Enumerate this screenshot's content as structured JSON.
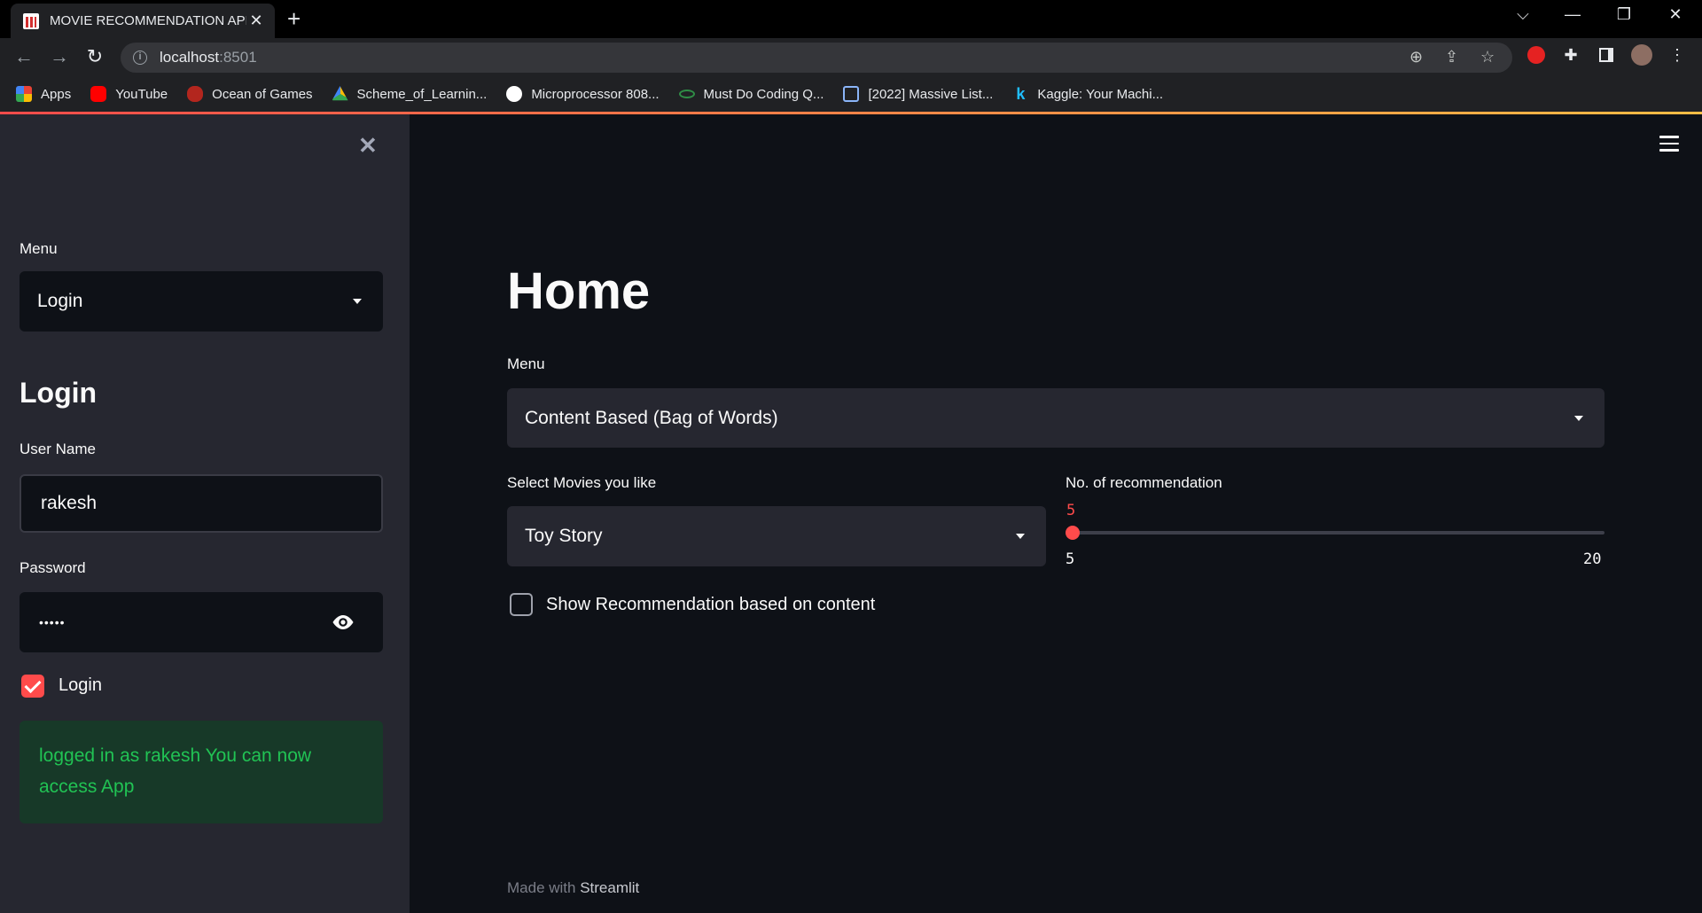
{
  "browser": {
    "tab_title": "MOVIE RECOMMENDATION APP",
    "url_host": "localhost",
    "url_port": ":8501",
    "bookmarks": [
      {
        "label": "Apps",
        "color": "#ea4335"
      },
      {
        "label": "YouTube",
        "color": "#ff0000"
      },
      {
        "label": "Ocean of Games",
        "color": "#b3261e"
      },
      {
        "label": "Scheme_of_Learnin...",
        "color": "#fbbc04"
      },
      {
        "label": "Microprocessor 808...",
        "color": "#ffffff"
      },
      {
        "label": "Must Do Coding Q...",
        "color": "#2f8d46"
      },
      {
        "label": "[2022] Massive List...",
        "color": "#8ab4f8"
      },
      {
        "label": "Kaggle: Your Machi...",
        "color": "#20beff"
      }
    ]
  },
  "sidebar": {
    "menu_label": "Menu",
    "menu_value": "Login",
    "heading": "Login",
    "username_label": "User Name",
    "username_value": "rakesh",
    "password_label": "Password",
    "password_value": "•••••",
    "login_checkbox_label": "Login",
    "login_checked": true,
    "success_message": "logged in as rakesh You can now access App"
  },
  "main": {
    "title": "Home",
    "menu_label": "Menu",
    "menu_value": "Content Based (Bag of Words)",
    "movies_label": "Select Movies you like",
    "movies_value": "Toy Story",
    "slider_label": "No. of recommendation",
    "slider_value": "5",
    "slider_min": "5",
    "slider_max": "20",
    "slider_fraction": 0.0,
    "show_checkbox_label": "Show Recommendation based on content",
    "show_checked": false,
    "footer_prefix": "Made with ",
    "footer_brand": "Streamlit"
  },
  "colors": {
    "accent": "#ff4b4b",
    "success_text": "#21c354",
    "success_bg": "#173928"
  }
}
